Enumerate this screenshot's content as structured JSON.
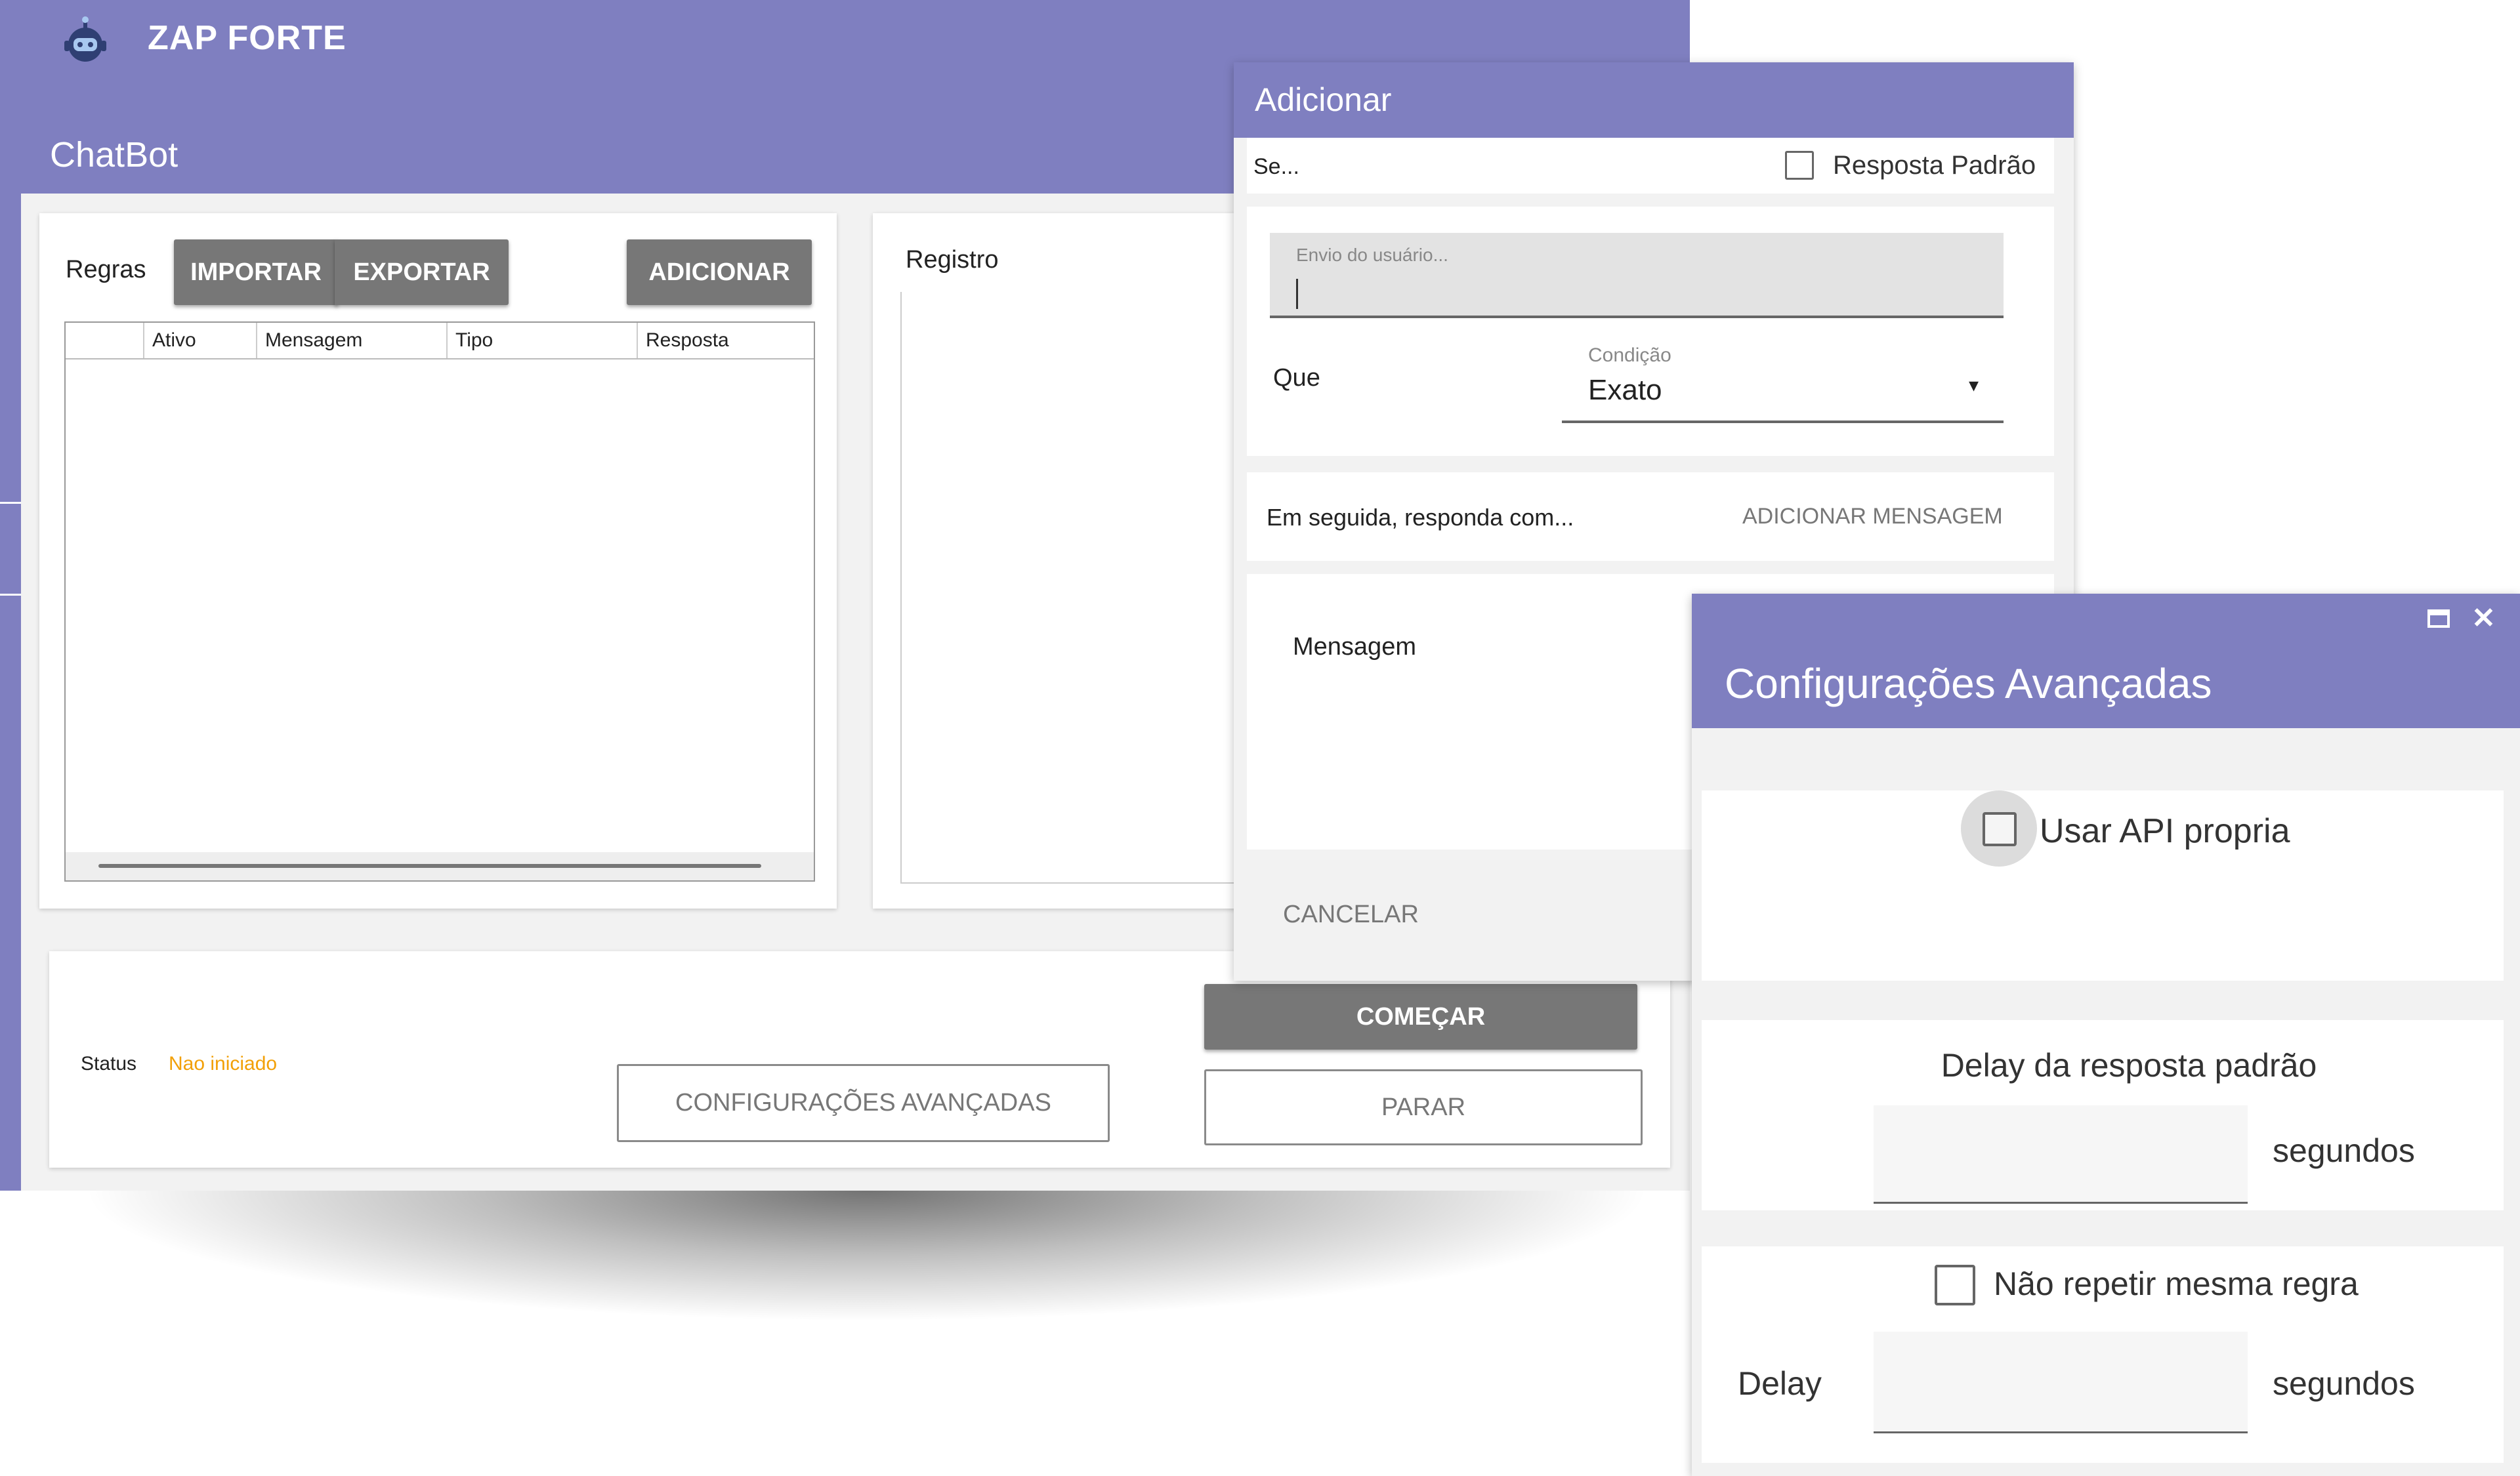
{
  "app": {
    "name": "ZAP FORTE",
    "page_title": "ChatBot"
  },
  "colors": {
    "accent": "#7f7fc0",
    "status": "#f2a007",
    "button_grey": "#777777"
  },
  "rules": {
    "label": "Regras",
    "import_label": "IMPORTAR",
    "export_label": "EXPORTAR",
    "add_label": "ADICIONAR",
    "columns": [
      "",
      "Ativo",
      "Mensagem",
      "Tipo",
      "Resposta"
    ]
  },
  "log": {
    "label": "Registro"
  },
  "status": {
    "label": "Status",
    "value": "Nao iniciado",
    "advanced_label": "CONFIGURAÇÕES AVANÇADAS",
    "start_label": "COMEÇAR",
    "stop_label": "PARAR"
  },
  "add_dialog": {
    "title": "Adicionar",
    "if_label": "Se...",
    "default_reply_label": "Resposta Padrão",
    "user_input_placeholder": "Envio do usuário...",
    "que_label": "Que",
    "condition_label": "Condição",
    "condition_value": "Exato",
    "then_label": "Em seguida, responda com...",
    "add_message_label": "ADICIONAR MENSAGEM",
    "message_label": "Mensagem",
    "cancel_label": "CANCELAR"
  },
  "advanced_dialog": {
    "title": "Configurações Avançadas",
    "own_api_label": "Usar API propria",
    "delay_title": "Delay da resposta padrão",
    "delay_unit": "segundos",
    "no_repeat_label": "Não repetir mesma regra",
    "delay2_label": "Delay",
    "delay2_unit": "segundos",
    "icons": [
      "maximize-icon",
      "close-icon"
    ]
  }
}
